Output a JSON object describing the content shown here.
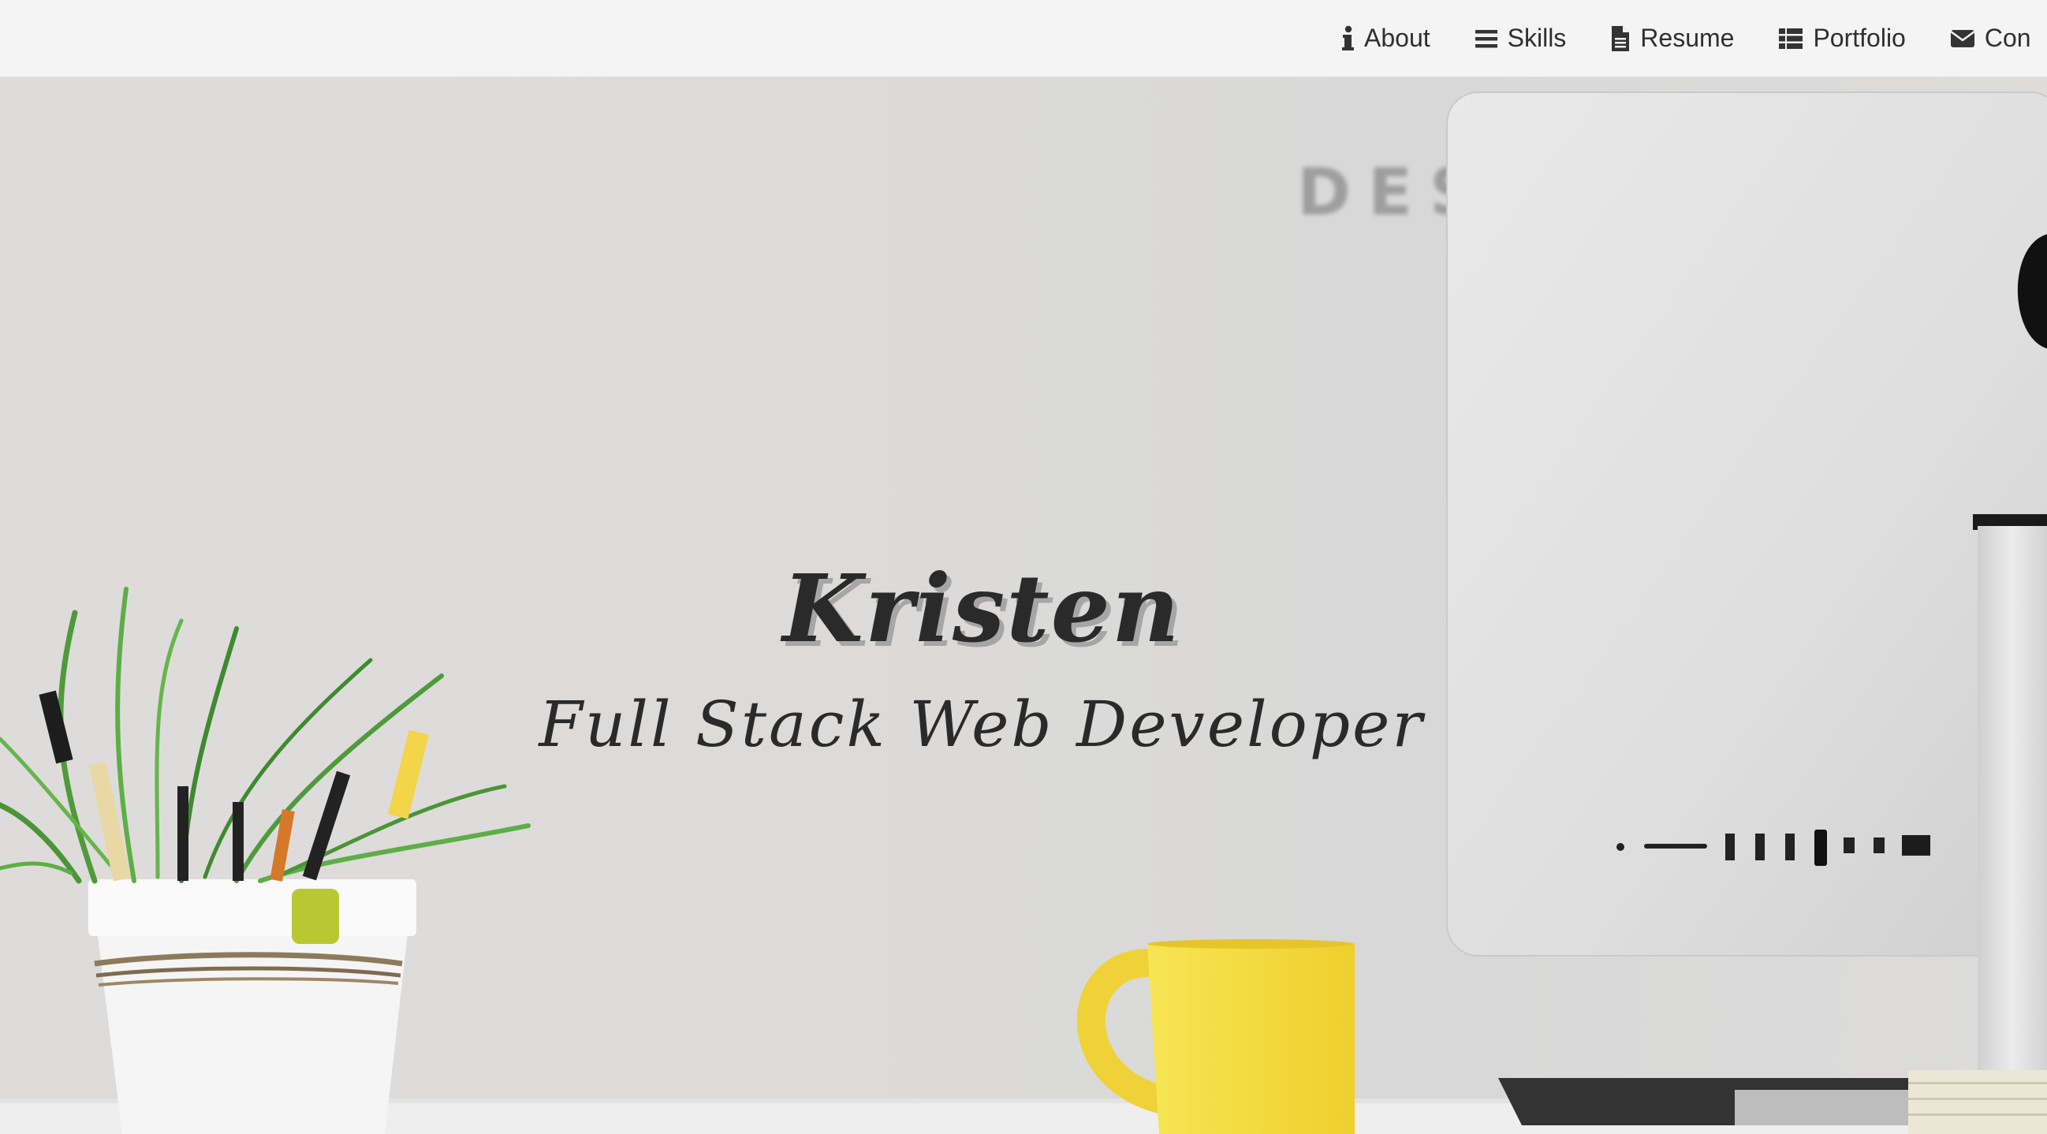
{
  "navbar": {
    "items": [
      {
        "label": "About",
        "icon": "info-icon"
      },
      {
        "label": "Skills",
        "icon": "bars-icon"
      },
      {
        "label": "Resume",
        "icon": "file-icon"
      },
      {
        "label": "Portfolio",
        "icon": "grid-icon"
      },
      {
        "label": "Con",
        "icon": "envelope-icon"
      }
    ]
  },
  "hero": {
    "name": "Kristen",
    "subtitle": "Full Stack Web Developer",
    "background_sign_text": "DES"
  },
  "colors": {
    "navbar_bg": "#f4f4f4",
    "text": "#2a2a2a",
    "mug_yellow": "#f3da3a"
  }
}
